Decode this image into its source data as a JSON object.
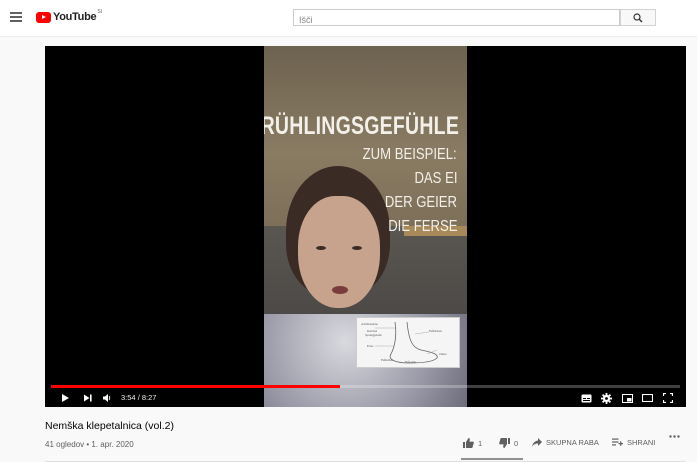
{
  "header": {
    "logo_text": "YouTube",
    "logo_country": "SI",
    "search_placeholder": "Išči"
  },
  "video": {
    "overlay_title": "FRÜHLINGSGEFÜHLE",
    "overlay_lines": [
      "ZUM BEISPIEL:",
      "DAS EI",
      "DER GEIER",
      "DIE FERSE"
    ],
    "diagram_labels": [
      "Achillessehne",
      "Knöchel",
      "Sprunggelenk",
      "Ferse",
      "Fußballen",
      "Fußrücken",
      "Zehen",
      "Fußsohle"
    ],
    "time_current": "3:54",
    "time_separator": " / ",
    "time_total": "8:27",
    "progress": 0.46
  },
  "info": {
    "title": "Nemška klepetalnica (vol.2)",
    "views": "41 ogledov",
    "dot": " • ",
    "date": "1. apr. 2020",
    "likes": "1",
    "dislikes": "0",
    "share_label": "SKUPNA RABA",
    "save_label": "SHRANI"
  }
}
